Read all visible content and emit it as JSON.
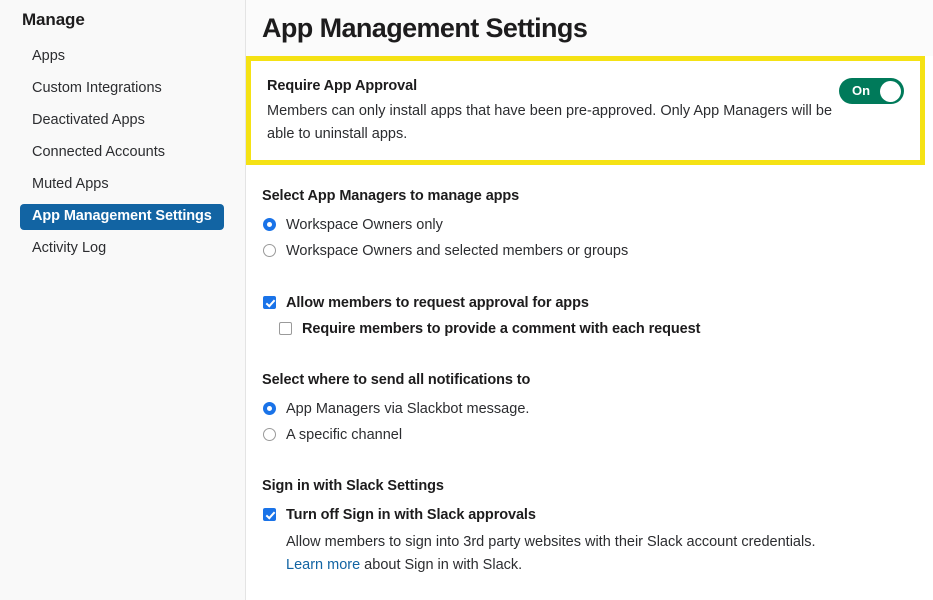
{
  "sidebar": {
    "title": "Manage",
    "items": [
      {
        "label": "Apps",
        "selected": false
      },
      {
        "label": "Custom Integrations",
        "selected": false
      },
      {
        "label": "Deactivated Apps",
        "selected": false
      },
      {
        "label": "Connected Accounts",
        "selected": false
      },
      {
        "label": "Muted Apps",
        "selected": false
      },
      {
        "label": "App Management Settings",
        "selected": true
      },
      {
        "label": "Activity Log",
        "selected": false
      }
    ]
  },
  "header": {
    "title": "App Management Settings"
  },
  "approval_card": {
    "title": "Require App Approval",
    "description": "Members can only install apps that have been pre-approved. Only App Managers will be able to uninstall apps.",
    "toggle_label": "On",
    "toggle_state": "on",
    "highlight_color": "#f5e214",
    "toggle_color": "#007a5a"
  },
  "app_managers": {
    "section_title": "Select App Managers to manage apps",
    "options": [
      {
        "label": "Workspace Owners only",
        "selected": true
      },
      {
        "label": "Workspace Owners and selected members or groups",
        "selected": false
      }
    ]
  },
  "request_approval": {
    "primary": {
      "label": "Allow members to request approval for apps",
      "checked": true
    },
    "secondary": {
      "label": "Require members to provide a comment with each request",
      "checked": false
    }
  },
  "notifications": {
    "section_title": "Select where to send all notifications to",
    "options": [
      {
        "label": "App Managers via Slackbot message.",
        "selected": true
      },
      {
        "label": "A specific channel",
        "selected": false
      }
    ]
  },
  "sign_in_with_slack": {
    "section_title": "Sign in with Slack Settings",
    "checkbox": {
      "label": "Turn off Sign in with Slack approvals",
      "checked": true
    },
    "description": "Allow members to sign into 3rd party websites with their Slack account credentials.",
    "link_text": "Learn more",
    "link_suffix": " about Sign in with Slack."
  },
  "colors": {
    "accent_blue": "#1264a3",
    "control_blue": "#1a73e8",
    "green": "#007a5a",
    "yellow": "#f5e214"
  }
}
